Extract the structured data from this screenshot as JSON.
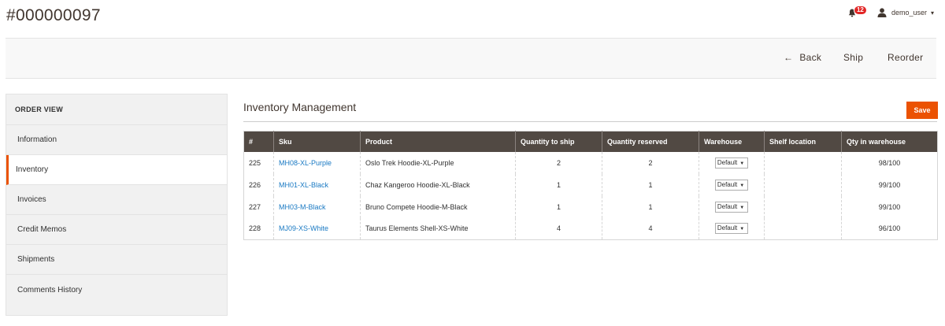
{
  "header": {
    "title": "#000000097",
    "notification_count": "12",
    "user_name": "demo_user",
    "caret": "▾"
  },
  "actions": {
    "back_label": "Back",
    "back_arrow": "←",
    "ship_label": "Ship",
    "reorder_label": "Reorder"
  },
  "sidebar": {
    "title": "ORDER VIEW",
    "items": [
      {
        "label": "Information"
      },
      {
        "label": "Inventory",
        "active": true
      },
      {
        "label": "Invoices"
      },
      {
        "label": "Credit Memos"
      },
      {
        "label": "Shipments"
      },
      {
        "label": "Comments History"
      }
    ]
  },
  "inventory": {
    "title": "Inventory Management",
    "save_label": "Save",
    "columns": [
      "#",
      "Sku",
      "Product",
      "Quantity to ship",
      "Quantity reserved",
      "Warehouse",
      "Shelf location",
      "Qty in warehouse"
    ],
    "rows": [
      {
        "id": "225",
        "sku": "MH08-XL-Purple",
        "product": "Oslo Trek Hoodie-XL-Purple",
        "qty_ship": "2",
        "qty_reserved": "2",
        "warehouse": "Default",
        "shelf": "",
        "qty_wh": "98/100"
      },
      {
        "id": "226",
        "sku": "MH01-XL-Black",
        "product": "Chaz Kangeroo Hoodie-XL-Black",
        "qty_ship": "1",
        "qty_reserved": "1",
        "warehouse": "Default",
        "shelf": "",
        "qty_wh": "99/100"
      },
      {
        "id": "227",
        "sku": "MH03-M-Black",
        "product": "Bruno Compete Hoodie-M-Black",
        "qty_ship": "1",
        "qty_reserved": "1",
        "warehouse": "Default",
        "shelf": "",
        "qty_wh": "99/100"
      },
      {
        "id": "228",
        "sku": "MJ09-XS-White",
        "product": "Taurus Elements Shell-XS-White",
        "qty_ship": "4",
        "qty_reserved": "4",
        "warehouse": "Default",
        "shelf": "",
        "qty_wh": "96/100"
      }
    ]
  },
  "colors": {
    "accent": "#eb5202",
    "table_header": "#514943",
    "link": "#1979c3",
    "badge": "#e22626"
  },
  "icons": {
    "notifications": "bell-icon",
    "user": "user-icon",
    "back": "arrow-left-icon",
    "dropdown": "chevron-down-icon"
  }
}
